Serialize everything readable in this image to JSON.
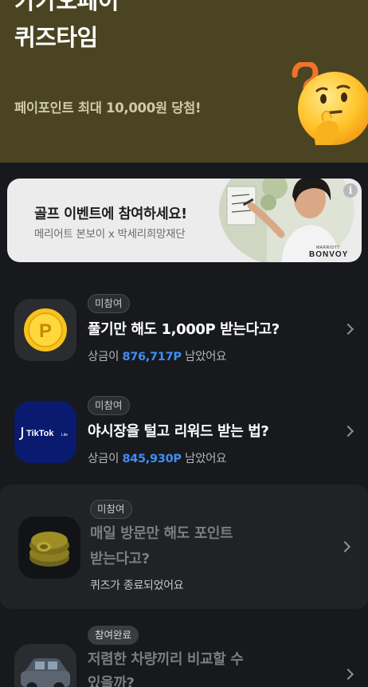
{
  "hero": {
    "title_line1": "카카오페이",
    "title_line2": "퀴즈타임",
    "subtitle": "페이포인트 최대 10,000원 당첨!",
    "mascot_icon": "thinking-face-emoji-icon",
    "background_color": "#4b4422"
  },
  "banner": {
    "title": "골프 이벤트에 참여하세요!",
    "subtitle": "메리어트 본보이 x 박세리희망재단",
    "brand_small": "MARRIOTT",
    "brand_large": "BONVOY",
    "info_icon": "info-icon",
    "info_glyph": "i"
  },
  "quizzes": [
    {
      "icon": "point-coin-icon",
      "badge": "미참여",
      "title": "풀기만 해도 1,000P 받는다고?",
      "meta_prefix": "상금이 ",
      "meta_amount": "876,717P",
      "meta_suffix": " 남았어요"
    },
    {
      "icon": "tiktok-lite-logo-icon",
      "icon_text": "TikTok",
      "icon_text_small": "Lite",
      "badge": "미참여",
      "title": "야시장을 털고 리워드 받는 법?",
      "meta_prefix": "상금이 ",
      "meta_amount": "845,930P",
      "meta_suffix": " 남았어요"
    },
    {
      "icon": "coin-stack-icon",
      "badge": "미참여",
      "title_line1": "매일 방문만 해도 포인트",
      "title_line2": "받는다고?",
      "status": "퀴즈가 종료되었어요"
    },
    {
      "icon": "car-icon",
      "badge": "참여완료",
      "title_line1": "저렴한 차량끼리 비교할 수",
      "title_line2": "있을까?"
    }
  ],
  "colors": {
    "accent_blue": "#3d8df5",
    "background": "#17191d"
  }
}
